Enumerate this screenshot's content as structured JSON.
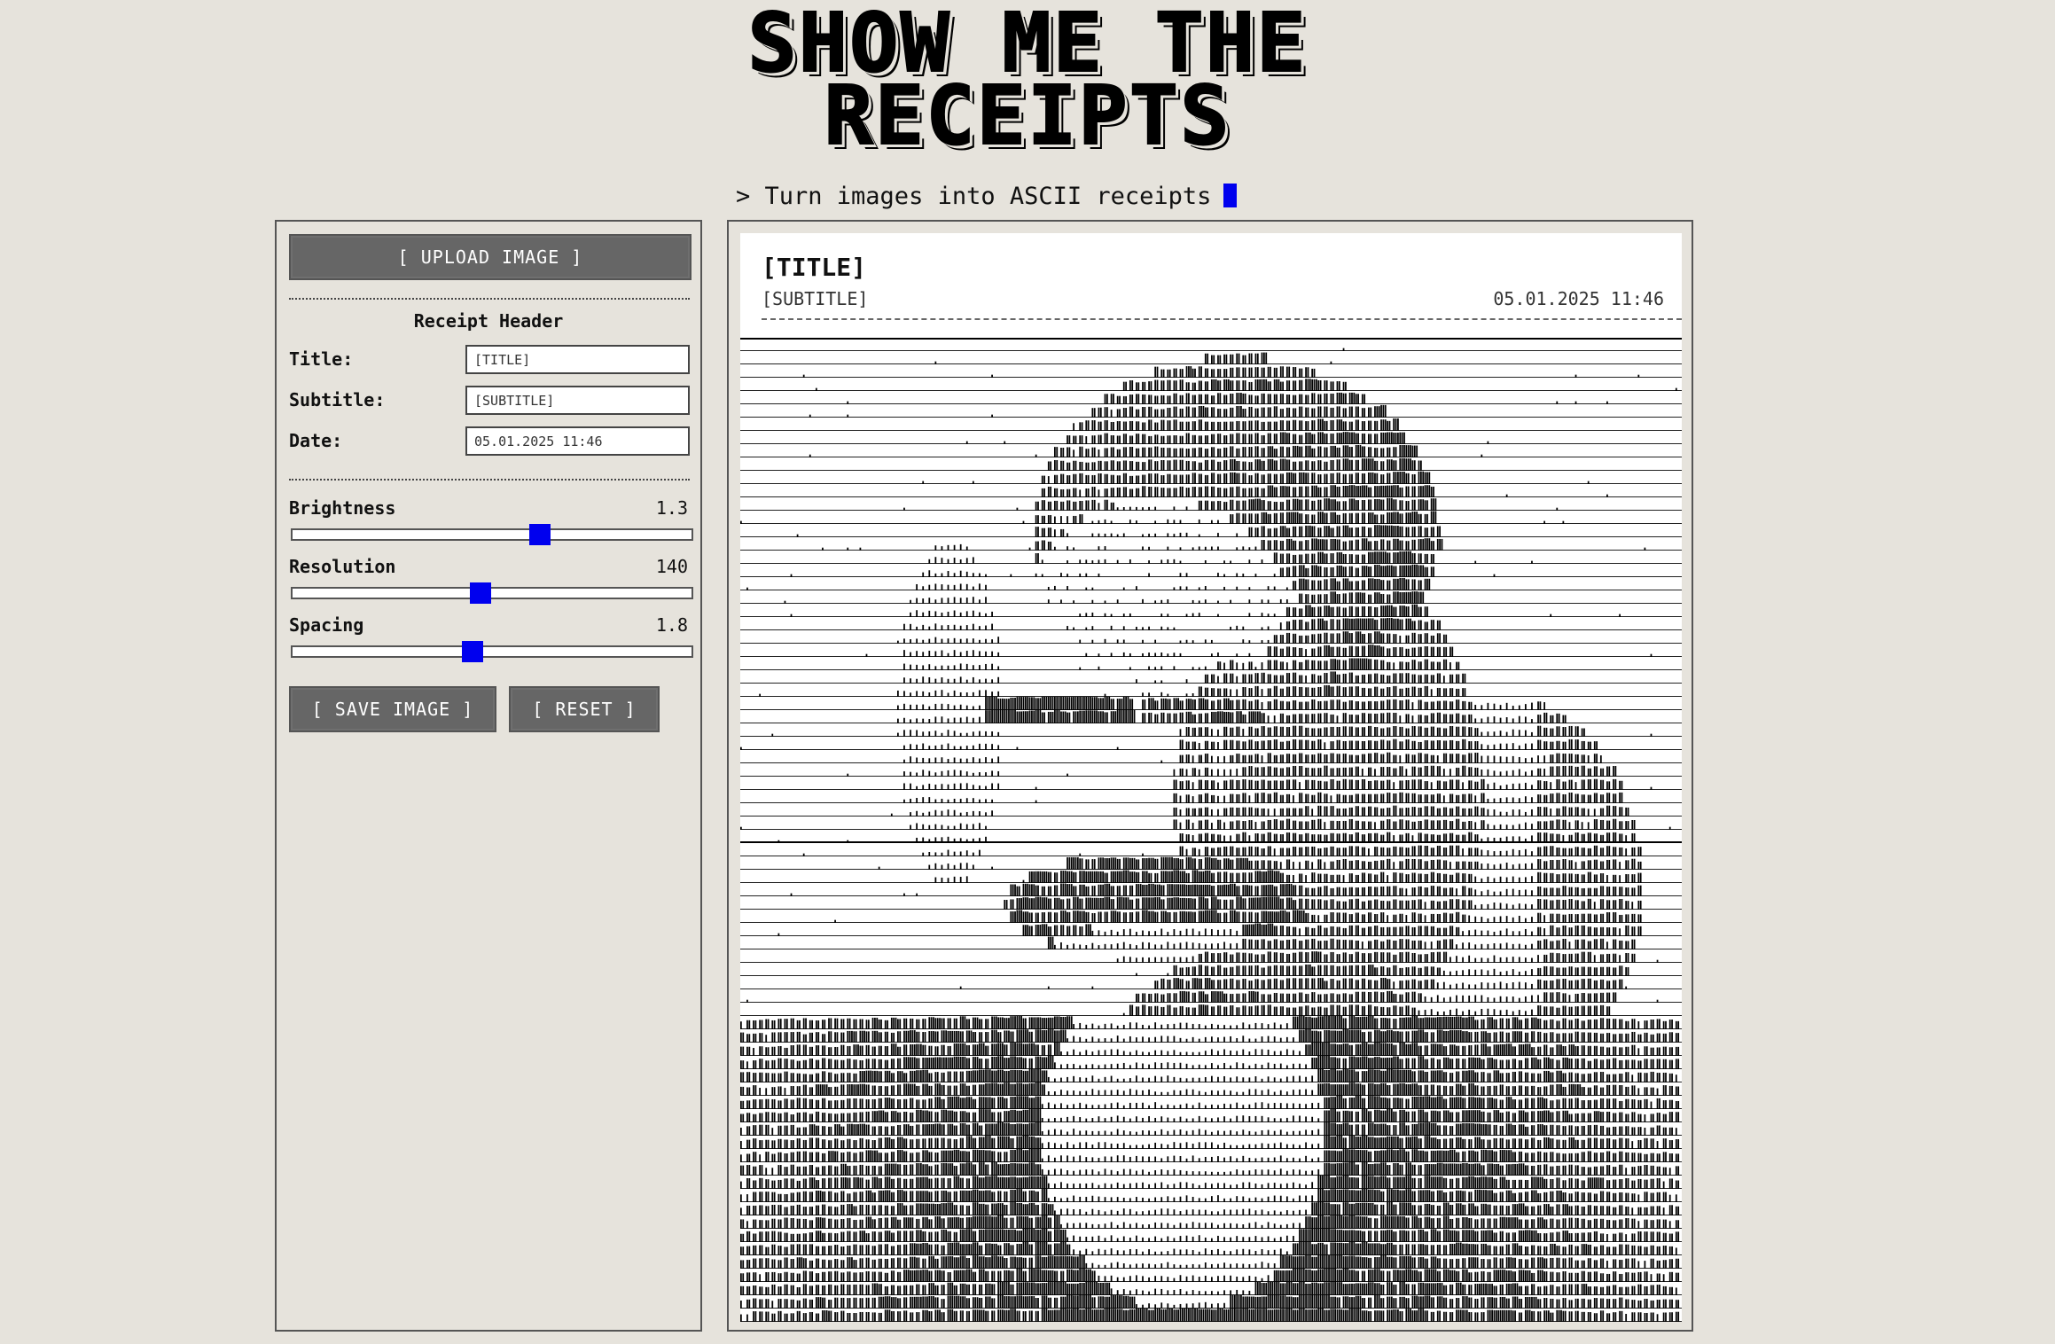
{
  "header": {
    "title_line1": "SHOW ME THE",
    "title_line2": "RECEIPTS",
    "tagline": "> Turn images into ASCII receipts"
  },
  "controls": {
    "upload_label": "[ UPLOAD IMAGE ]",
    "section_title": "Receipt Header",
    "title_label": "Title:",
    "title_value": "[TITLE]",
    "subtitle_label": "Subtitle:",
    "subtitle_value": "[SUBTITLE]",
    "date_label": "Date:",
    "date_value": "05.01.2025 11:46",
    "brightness_label": "Brightness",
    "brightness_value": "1.3",
    "brightness_fraction": 0.62,
    "resolution_label": "Resolution",
    "resolution_value": "140",
    "resolution_fraction": 0.47,
    "spacing_label": "Spacing",
    "spacing_value": "1.8",
    "spacing_fraction": 0.45,
    "save_label": "[ SAVE IMAGE ]",
    "reset_label": "[ RESET ]"
  },
  "receipt": {
    "title": "[TITLE]",
    "subtitle": "[SUBTITLE]",
    "date": "05.01.2025 11:46"
  },
  "colors": {
    "accent": "#0000ee",
    "background": "#e6e3dc",
    "button": "#666666"
  }
}
